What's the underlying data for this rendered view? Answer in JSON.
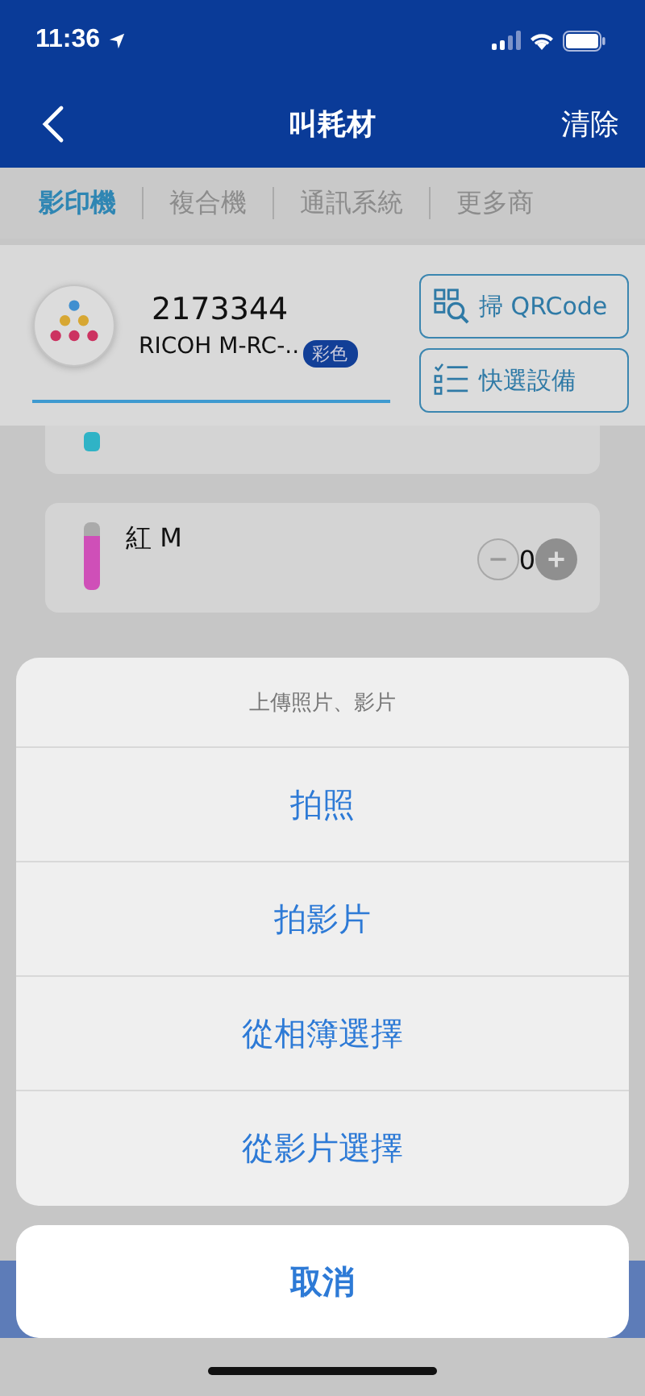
{
  "status_bar": {
    "time": "11:36"
  },
  "nav": {
    "title": "叫耗材",
    "action": "清除"
  },
  "tabs": [
    {
      "label": "影印機",
      "selected": true
    },
    {
      "label": "複合機",
      "selected": false
    },
    {
      "label": "通訊系統",
      "selected": false
    },
    {
      "label": "更多商",
      "selected": false
    }
  ],
  "device": {
    "number": "2173344",
    "model": "RICOH M-RC-..",
    "badge": "彩色",
    "buttons": [
      {
        "kind": "qr",
        "label": "掃 QRCode"
      },
      {
        "kind": "list",
        "label": "快選設備"
      }
    ]
  },
  "items": [
    {
      "color": "#2fb3c6"
    },
    {
      "name": "紅 M",
      "color": "#cf4fb8",
      "quantity": "0"
    }
  ],
  "action_sheet": {
    "title": "上傳照片、影片",
    "options": [
      "拍照",
      "拍影片",
      "從相簿選擇",
      "從影片選擇"
    ],
    "cancel": "取消"
  }
}
